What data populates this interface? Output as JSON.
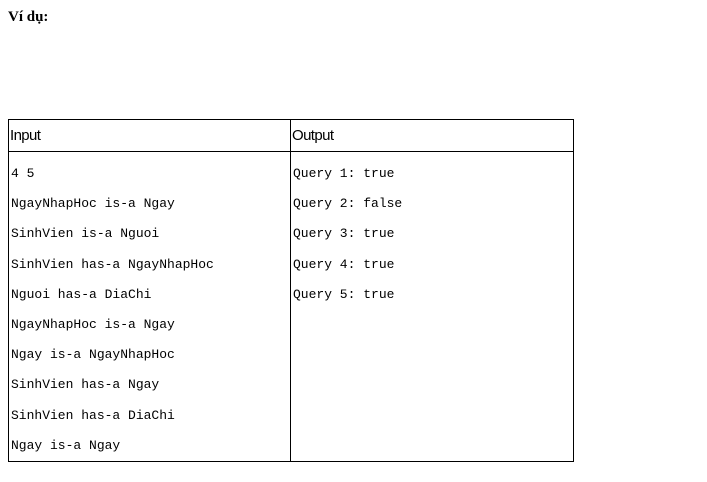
{
  "heading": "Ví dụ:",
  "table": {
    "headers": [
      "Input",
      "Output"
    ],
    "input_lines": [
      "4 5",
      "NgayNhapHoc is-a Ngay",
      "SinhVien is-a Nguoi",
      "SinhVien has-a NgayNhapHoc",
      "Nguoi has-a DiaChi",
      "NgayNhapHoc is-a Ngay",
      "Ngay is-a NgayNhapHoc",
      "SinhVien has-a Ngay",
      "SinhVien has-a DiaChi",
      "Ngay is-a Ngay"
    ],
    "output_lines": [
      "Query 1: true",
      "Query 2: false",
      "Query 3: true",
      "Query 4: true",
      "Query 5: true"
    ]
  }
}
